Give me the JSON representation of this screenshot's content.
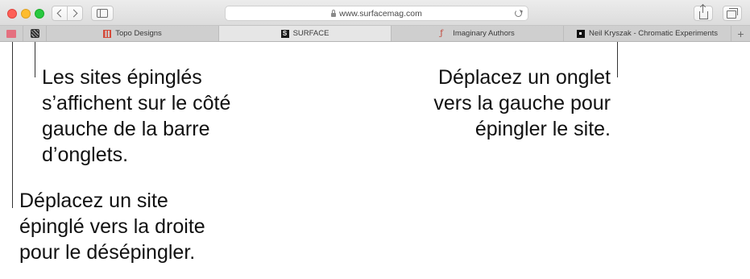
{
  "browser": {
    "address_bar": {
      "url": "www.surfacemag.com"
    },
    "toolbar": {
      "back_icon": "chevron-left-icon",
      "forward_icon": "chevron-right-icon",
      "sidebar_icon": "sidebar-icon",
      "share_icon": "share-icon",
      "tab_overview_icon": "tab-overview-icon",
      "lock_icon": "lock-icon",
      "reload_icon": "reload-icon"
    },
    "tabs": [
      {
        "label": "Topo Designs",
        "active": false
      },
      {
        "label": "SURFACE",
        "active": true,
        "favicon_letter": "S"
      },
      {
        "label": "Imaginary Authors",
        "active": false,
        "favicon_letter": "ƒ"
      },
      {
        "label": "Neil Kryszak - Chromatic Experiments",
        "active": false
      }
    ],
    "new_tab_symbol": "+",
    "colors": {
      "close": "#fe5f57",
      "minimize": "#febc2e",
      "zoom": "#28c840"
    }
  },
  "callouts": {
    "pinned_sites": [
      "Les sites épinglés",
      "s’affichent sur le côté",
      "gauche de la barre",
      "d’onglets."
    ],
    "drag_to_pin": [
      "Déplacez un onglet",
      "vers la gauche pour",
      "épingler le site."
    ],
    "drag_to_unpin": [
      "Déplacez un site",
      "épinglé vers la droite",
      "pour le désépingler."
    ]
  }
}
